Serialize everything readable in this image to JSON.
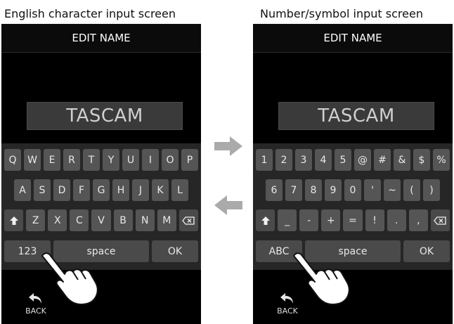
{
  "captions": {
    "left": "English character input screen",
    "right": "Number/symbol input screen"
  },
  "screen_common": {
    "title": "EDIT NAME",
    "name_value": "TASCAM",
    "back_label": "BACK",
    "space_label": "space",
    "ok_label": "OK"
  },
  "left_keyboard": {
    "row1": [
      "Q",
      "W",
      "E",
      "R",
      "T",
      "Y",
      "U",
      "I",
      "O",
      "P"
    ],
    "row2": [
      "A",
      "S",
      "D",
      "F",
      "G",
      "H",
      "J",
      "K",
      "L"
    ],
    "row3": [
      "Z",
      "X",
      "C",
      "V",
      "B",
      "N",
      "M"
    ],
    "mode_key": "123"
  },
  "right_keyboard": {
    "row1": [
      "1",
      "2",
      "3",
      "4",
      "5",
      "@",
      "#",
      "&",
      "$",
      "%"
    ],
    "row2": [
      "6",
      "7",
      "8",
      "9",
      "0",
      "'",
      "~",
      "(",
      ")"
    ],
    "row3": [
      "_",
      "-",
      "+",
      "=",
      "!",
      ".",
      ","
    ],
    "mode_key": "ABC"
  },
  "icons": {
    "shift": "shift-up-arrow-icon",
    "backspace": "backspace-icon",
    "back": "back-arrow-icon",
    "hand": "pointing-hand-icon",
    "arrow_right": "arrow-right-icon",
    "arrow_left": "arrow-left-icon"
  },
  "colors": {
    "screen_bg": "#000000",
    "keyboard_bg": "#262626",
    "key_bg": "#555555",
    "arrow": "#aaaaaa"
  }
}
